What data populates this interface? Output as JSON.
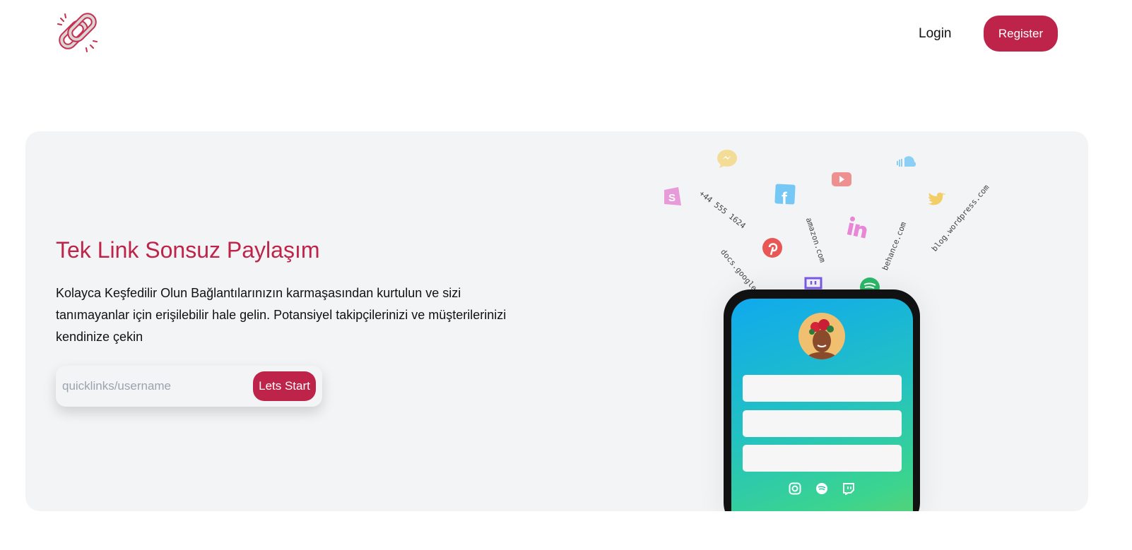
{
  "header": {
    "login_label": "Login",
    "register_label": "Register"
  },
  "hero": {
    "title": "Tek Link Sonsuz Paylaşım",
    "description": "Kolayca Keşfedilir Olun Bağlantılarınızın karmaşasından kurtulun ve sizi tanımayanlar için erişilebilir hale gelin. Potansiyel takipçilerinizi ve müşterilerinizi kendinize çekin",
    "input_placeholder": "quicklinks/username",
    "start_label": "Lets Start"
  },
  "floating_texts": [
    "+44 555 1624",
    "amazon.com",
    "docs.google.com",
    "behance.com",
    "blog.wordpress.com"
  ],
  "colors": {
    "accent": "#be244a",
    "card": "#f3f4f6"
  }
}
